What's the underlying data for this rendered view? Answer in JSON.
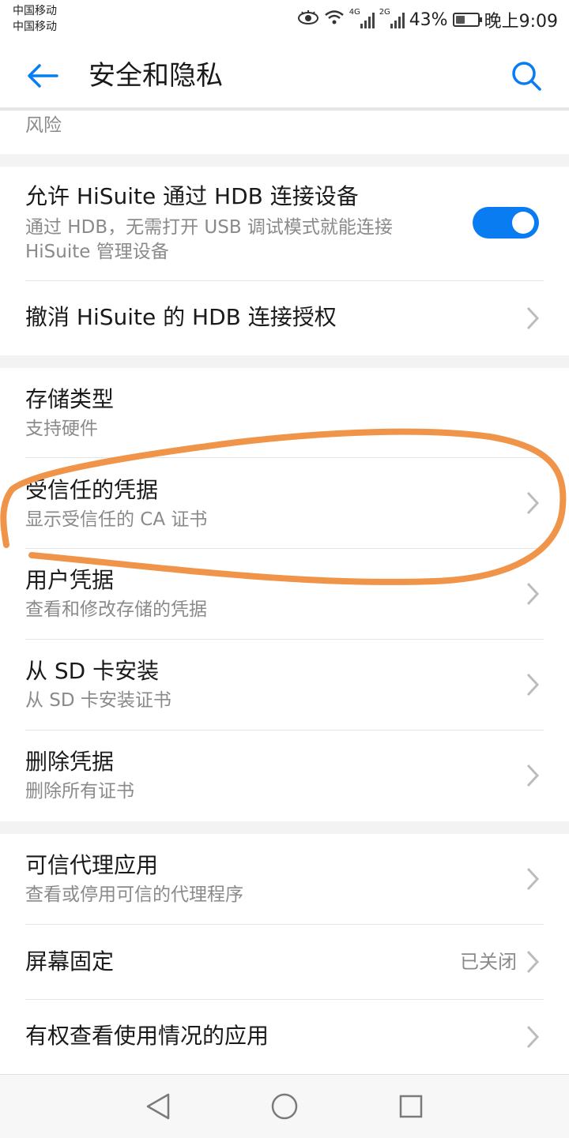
{
  "status_bar": {
    "carrier_1": "中国移动",
    "carrier_2": "中国移动",
    "net1": "4G",
    "net2": "2G",
    "battery_text": "43%",
    "battery_level": 0.43,
    "time": "晚上9:09"
  },
  "header": {
    "title": "安全和隐私",
    "back_icon": "arrow-left-icon",
    "search_icon": "search-icon"
  },
  "partial_item": {
    "subtitle": "风险"
  },
  "hdb": {
    "allow_title": "允许 HiSuite 通过 HDB 连接设备",
    "allow_sub_1": "通过 HDB，无需打开 USB 调试模式就能连接",
    "allow_sub_2": "HiSuite 管理设备",
    "allow_on": true,
    "revoke_title": "撤消 HiSuite 的 HDB 连接授权"
  },
  "credentials": {
    "storage_title": "存储类型",
    "storage_sub": "支持硬件",
    "trusted_title": "受信任的凭据",
    "trusted_sub": "显示受信任的 CA 证书",
    "user_title": "用户凭据",
    "user_sub": "查看和修改存储的凭据",
    "sd_title": "从 SD 卡安装",
    "sd_sub": "从 SD 卡安装证书",
    "delete_title": "删除凭据",
    "delete_sub": "删除所有证书"
  },
  "other": {
    "agent_title": "可信代理应用",
    "agent_sub": "查看或停用可信的代理程序",
    "pin_title": "屏幕固定",
    "pin_value": "已关闭",
    "usage_title": "有权查看使用情况的应用"
  },
  "colors": {
    "accent": "#0a7cf2",
    "annotation": "#f0944a"
  },
  "nav": {
    "back": "triangle-back-icon",
    "home": "circle-home-icon",
    "recents": "square-recents-icon"
  }
}
